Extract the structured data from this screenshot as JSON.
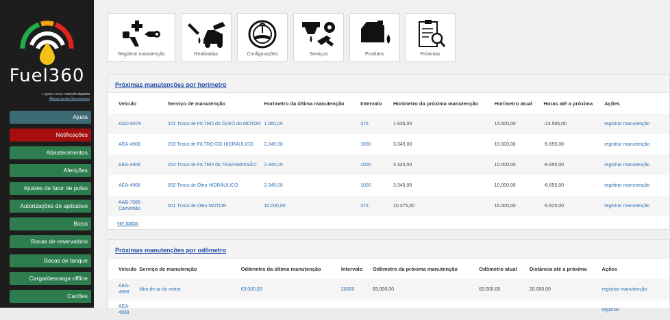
{
  "brand": {
    "name": "Fuel360"
  },
  "user": {
    "prefix": "Logado como:",
    "name": "marcelo.siqueira",
    "links": "Alterar senha Desconectar"
  },
  "menu": [
    {
      "label": "Ajuda",
      "kind": "help"
    },
    {
      "label": "Notificações",
      "kind": "notif"
    },
    {
      "label": "Abastecimentos",
      "kind": "normal"
    },
    {
      "label": "Aferições",
      "kind": "normal"
    },
    {
      "label": "Ajustes de fator de pulso",
      "kind": "normal"
    },
    {
      "label": "Autorizações de aplicativo",
      "kind": "normal"
    },
    {
      "label": "Bicos",
      "kind": "normal"
    },
    {
      "label": "Bocas de reservatório",
      "kind": "normal"
    },
    {
      "label": "Bocas de tanque",
      "kind": "normal"
    },
    {
      "label": "Carga/descarga offline",
      "kind": "normal"
    },
    {
      "label": "Cartões",
      "kind": "normal"
    }
  ],
  "tiles": [
    {
      "label": "Registrar manutenção",
      "icon": "wrench-plus-icon"
    },
    {
      "label": "Realizadas",
      "icon": "car-oil-icon"
    },
    {
      "label": "Configurações",
      "icon": "steering-wheel-icon"
    },
    {
      "label": "Serviços",
      "icon": "oil-service-icon"
    },
    {
      "label": "Produtos",
      "icon": "oil-can-icon"
    },
    {
      "label": "Próximas",
      "icon": "clipboard-search-icon"
    }
  ],
  "horimetro": {
    "title": "Próximas manutenções por horímetro",
    "headers": [
      "Veículo",
      "Serviço de manutenção",
      "Horímetro da última manutenção",
      "Intervalo",
      "Horímetro da próxima manutenção",
      "Horímetro atual",
      "Horas até a próxima",
      "Ações"
    ],
    "rows": [
      [
        "AAO-8378",
        "201 Troca de FILTRO do ÓLEO do MOTOR",
        "1.560,00",
        "375",
        "1.935,00",
        "15.500,00",
        "-13.565,00",
        "registrar manutenção"
      ],
      [
        "AEA-4908",
        "203 Troca de FILTRO DO HIDRÁULICO",
        "2.345,00",
        "1000",
        "3.345,00",
        "10.000,00",
        "-6.655,00",
        "registrar manutenção"
      ],
      [
        "AEA-4908",
        "204 Troca de FILTRO da TRANSMISSÃO",
        "2.345,00",
        "1000",
        "3.345,00",
        "10.000,00",
        "-6.655,00",
        "registrar manutenção"
      ],
      [
        "AEA-4908",
        "002 Troca de Óleo HIDRÁULICO",
        "2.345,00",
        "1000",
        "3.345,00",
        "10.000,00",
        "-6.655,00",
        "registrar manutenção"
      ],
      [
        "AAB-7085 - Caminhão",
        "001 Troca de Óleo MOTOR",
        "10.000,00",
        "375",
        "10.375,00",
        "16.000,00",
        "-5.625,00",
        "registrar manutenção"
      ]
    ],
    "more": "ver todos"
  },
  "odometro": {
    "title": "Próximas manutenções por odômetro",
    "headers": [
      "Veículo",
      "Serviço de manutenção",
      "Odômetro da última manutenção",
      "Intervalo",
      "Odômetro da próxima manutenção",
      "Odômetro atual",
      "Distância até a próxima",
      "Ações"
    ],
    "rows": [
      [
        "AEA-4908",
        "filtro de ar do motor",
        "63.000,00",
        "20000",
        "83.000,00",
        "63.000,00",
        "20.000,00",
        "registrar manutenção"
      ],
      [
        "AEA-4908",
        "",
        "",
        "",
        "",
        "",
        "",
        "registrar"
      ]
    ]
  }
}
